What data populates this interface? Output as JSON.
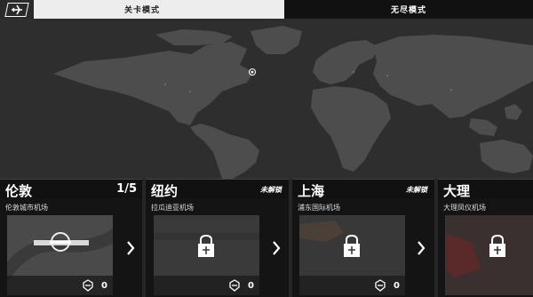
{
  "tabs": [
    {
      "label": "关卡模式",
      "active": true
    },
    {
      "label": "无尽模式",
      "active": false
    }
  ],
  "icons": {
    "back": "back-plane-icon",
    "lock": "lock-plane-icon",
    "badge": "wing-badge-icon",
    "next": "chevron-right-icon",
    "map_marker": "location-marker-icon"
  },
  "colors": {
    "active_tab_bg": "#ededed",
    "inactive_tab_bg": "#111111",
    "map_land": "#505050",
    "map_sea": "#2e2e2e"
  },
  "cards": [
    {
      "city": "伦敦",
      "progress": "1/5",
      "airport": "伦敦城市机场",
      "score": "0",
      "locked": false
    },
    {
      "city": "纽约",
      "status": "未解锁",
      "airport": "拉瓜迪亚机场",
      "score": "0",
      "locked": true
    },
    {
      "city": "上海",
      "status": "未解锁",
      "airport": "浦东国际机场",
      "score": "0",
      "locked": true
    },
    {
      "city": "大理",
      "airport": "大理凤仪机场",
      "locked": true
    }
  ]
}
